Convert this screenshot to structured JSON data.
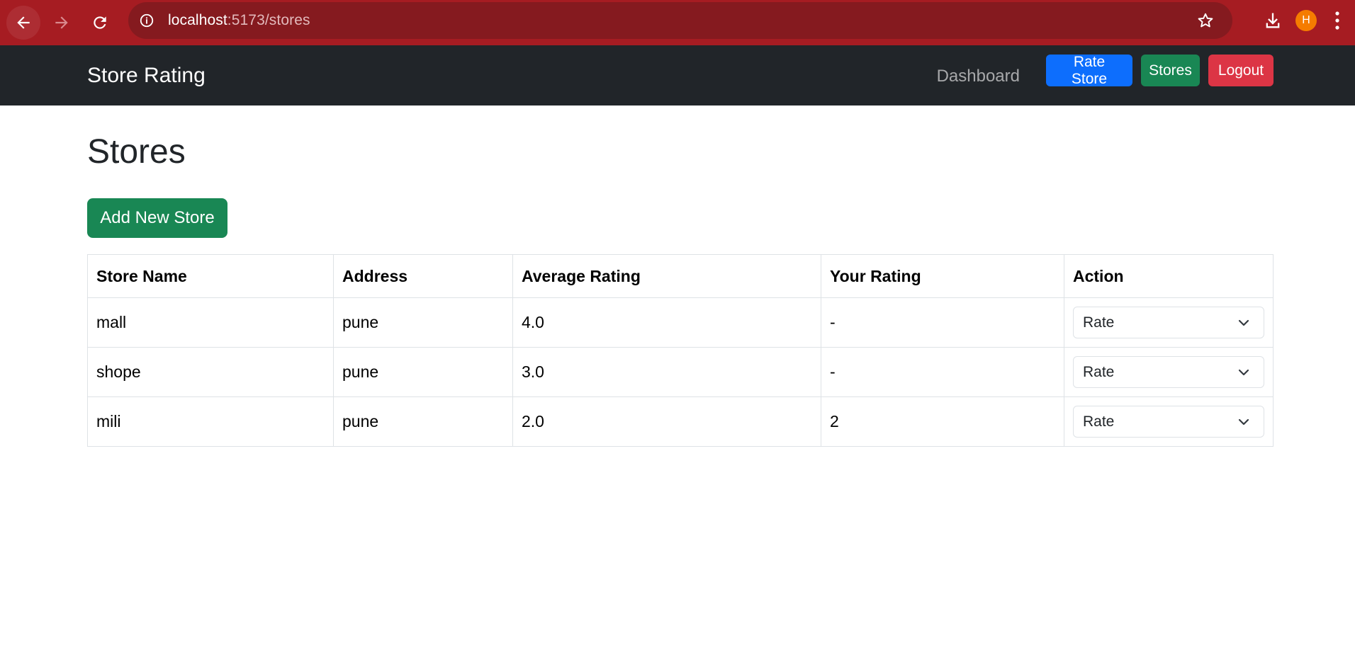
{
  "browser": {
    "url_host": "localhost",
    "url_path": ":5173/stores",
    "profile_initial": "H",
    "theme_color": "#a61c22"
  },
  "navbar": {
    "brand": "Store Rating",
    "dashboard_link": "Dashboard",
    "rate_store_button": "Rate Store",
    "stores_button": "Stores",
    "logout_button": "Logout"
  },
  "page": {
    "title": "Stores",
    "add_button": "Add New Store"
  },
  "table": {
    "headers": [
      "Store Name",
      "Address",
      "Average Rating",
      "Your Rating",
      "Action"
    ],
    "rows": [
      {
        "name": "mall",
        "address": "pune",
        "average": "4.0",
        "yours": "-",
        "action": "Rate"
      },
      {
        "name": "shope",
        "address": "pune",
        "average": "3.0",
        "yours": "-",
        "action": "Rate"
      },
      {
        "name": "mili",
        "address": "pune",
        "average": "2.0",
        "yours": "2",
        "action": "Rate"
      }
    ]
  },
  "colors": {
    "primary": "#0d6efd",
    "success": "#198754",
    "danger": "#dc3545",
    "navbar_bg": "#212529"
  }
}
